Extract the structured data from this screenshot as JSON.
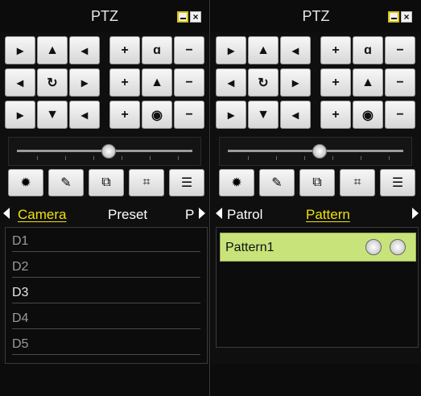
{
  "left": {
    "title": "PTZ",
    "tabs": [
      {
        "label": "Camera",
        "active": true
      },
      {
        "label": "Preset",
        "active": false
      },
      {
        "label": "P",
        "active": false
      }
    ],
    "items": [
      "D1",
      "D2",
      "D3",
      "D4",
      "D5"
    ],
    "active_item": "D3"
  },
  "right": {
    "title": "PTZ",
    "tabs": [
      {
        "label": "Patrol",
        "active": false
      },
      {
        "label": "Pattern",
        "active": true
      }
    ],
    "patterns": [
      "Pattern1"
    ]
  },
  "controls": {
    "direction_buttons": [
      "arrow-upleft-icon",
      "arrow-up-icon",
      "arrow-upright-icon",
      "arrow-left-icon",
      "auto-scan-icon",
      "arrow-right-icon",
      "arrow-downleft-icon",
      "arrow-down-icon",
      "arrow-downright-icon"
    ],
    "zoom_in": "+",
    "zoom_out": "−",
    "focus_in": "+",
    "focus_out": "−",
    "iris_in": "+",
    "iris_out": "−"
  },
  "colors": {
    "active_tab": "#f0e20a",
    "pattern_bg": "#c7e37a"
  }
}
